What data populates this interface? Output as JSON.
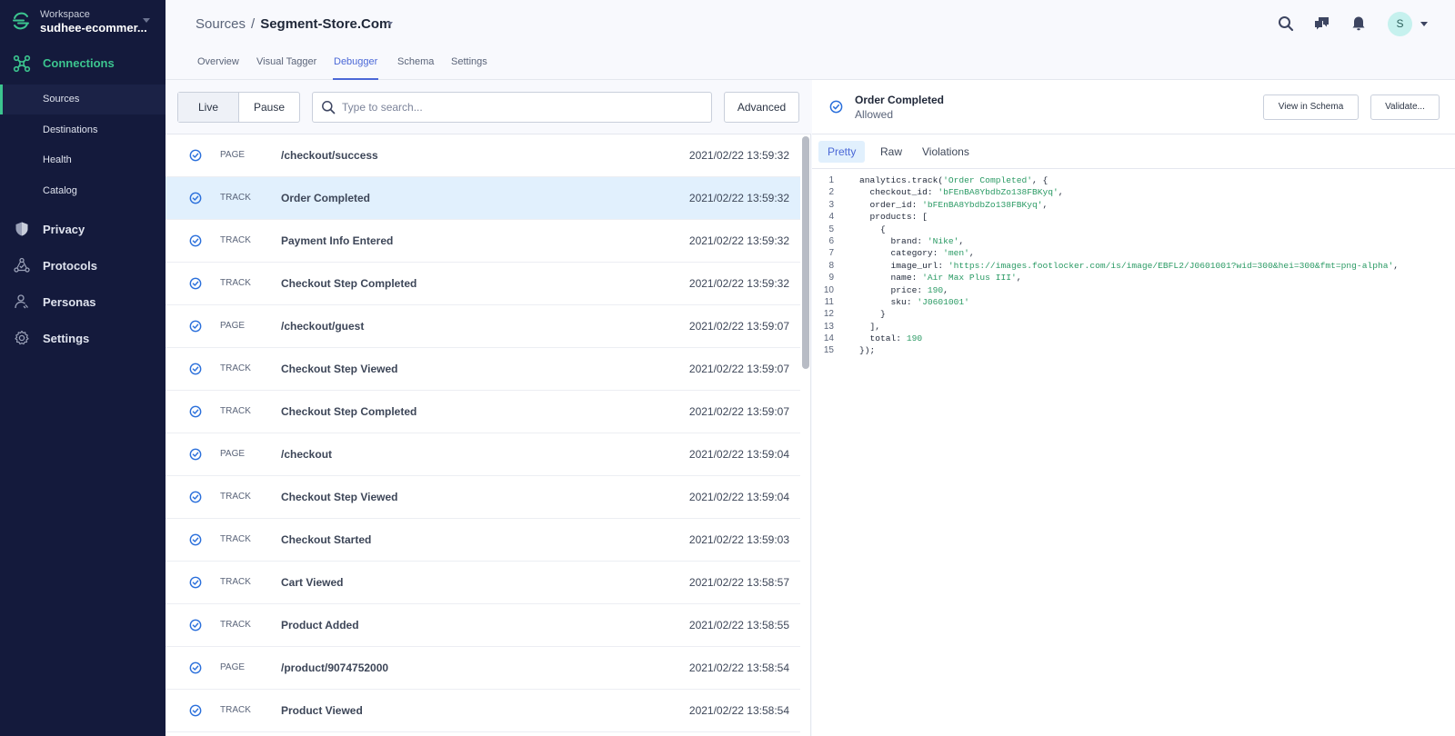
{
  "sidebar": {
    "workspace_label": "Workspace",
    "workspace_name": "sudhee-ecommer...",
    "connections_label": "Connections",
    "sub_items": [
      "Sources",
      "Destinations",
      "Health",
      "Catalog"
    ],
    "active_sub": "Sources",
    "items": [
      {
        "label": "Privacy",
        "icon": "shield-icon"
      },
      {
        "label": "Protocols",
        "icon": "protocols-icon"
      },
      {
        "label": "Personas",
        "icon": "persona-icon"
      },
      {
        "label": "Settings",
        "icon": "gear-icon"
      }
    ],
    "accent_color": "#3cc58f"
  },
  "header": {
    "breadcrumb_root": "Sources",
    "breadcrumb_sep": "/",
    "breadcrumb_current": "Segment-Store.Com",
    "tabs": [
      "Overview",
      "Visual Tagger",
      "Debugger",
      "Schema",
      "Settings"
    ],
    "active_tab": "Debugger",
    "avatar_initial": "S"
  },
  "toolbar": {
    "live_label": "Live",
    "pause_label": "Pause",
    "search_placeholder": "Type to search...",
    "search_value": "",
    "advanced_label": "Advanced"
  },
  "events": [
    {
      "type": "PAGE",
      "name": "/checkout/success",
      "timestamp": "2021/02/22 13:59:32",
      "selected": false
    },
    {
      "type": "TRACK",
      "name": "Order Completed",
      "timestamp": "2021/02/22 13:59:32",
      "selected": true
    },
    {
      "type": "TRACK",
      "name": "Payment Info Entered",
      "timestamp": "2021/02/22 13:59:32",
      "selected": false
    },
    {
      "type": "TRACK",
      "name": "Checkout Step Completed",
      "timestamp": "2021/02/22 13:59:32",
      "selected": false
    },
    {
      "type": "PAGE",
      "name": "/checkout/guest",
      "timestamp": "2021/02/22 13:59:07",
      "selected": false
    },
    {
      "type": "TRACK",
      "name": "Checkout Step Viewed",
      "timestamp": "2021/02/22 13:59:07",
      "selected": false
    },
    {
      "type": "TRACK",
      "name": "Checkout Step Completed",
      "timestamp": "2021/02/22 13:59:07",
      "selected": false
    },
    {
      "type": "PAGE",
      "name": "/checkout",
      "timestamp": "2021/02/22 13:59:04",
      "selected": false
    },
    {
      "type": "TRACK",
      "name": "Checkout Step Viewed",
      "timestamp": "2021/02/22 13:59:04",
      "selected": false
    },
    {
      "type": "TRACK",
      "name": "Checkout Started",
      "timestamp": "2021/02/22 13:59:03",
      "selected": false
    },
    {
      "type": "TRACK",
      "name": "Cart Viewed",
      "timestamp": "2021/02/22 13:58:57",
      "selected": false
    },
    {
      "type": "TRACK",
      "name": "Product Added",
      "timestamp": "2021/02/22 13:58:55",
      "selected": false
    },
    {
      "type": "PAGE",
      "name": "/product/9074752000",
      "timestamp": "2021/02/22 13:58:54",
      "selected": false
    },
    {
      "type": "TRACK",
      "name": "Product Viewed",
      "timestamp": "2021/02/22 13:58:54",
      "selected": false
    }
  ],
  "detail": {
    "title": "Order Completed",
    "status": "Allowed",
    "view_schema_label": "View in Schema",
    "validate_label": "Validate...",
    "tabs": [
      "Pretty",
      "Raw",
      "Violations"
    ],
    "active_tab": "Pretty",
    "code_lines": [
      [
        [
          "p",
          "analytics.track("
        ],
        [
          "s",
          "'Order Completed'"
        ],
        [
          "p",
          ", {"
        ]
      ],
      [
        [
          "p",
          "  checkout_id: "
        ],
        [
          "s",
          "'bFEnBA8YbdbZo138FBKyq'"
        ],
        [
          "p",
          ","
        ]
      ],
      [
        [
          "p",
          "  order_id: "
        ],
        [
          "s",
          "'bFEnBA8YbdbZo138FBKyq'"
        ],
        [
          "p",
          ","
        ]
      ],
      [
        [
          "p",
          "  products: ["
        ]
      ],
      [
        [
          "p",
          "    {"
        ]
      ],
      [
        [
          "p",
          "      brand: "
        ],
        [
          "s",
          "'Nike'"
        ],
        [
          "p",
          ","
        ]
      ],
      [
        [
          "p",
          "      category: "
        ],
        [
          "s",
          "'men'"
        ],
        [
          "p",
          ","
        ]
      ],
      [
        [
          "p",
          "      image_url: "
        ],
        [
          "s",
          "'https://images.footlocker.com/is/image/EBFL2/J0601001?wid=300&hei=300&fmt=png-alpha'"
        ],
        [
          "p",
          ","
        ]
      ],
      [
        [
          "p",
          "      name: "
        ],
        [
          "s",
          "'Air Max Plus III'"
        ],
        [
          "p",
          ","
        ]
      ],
      [
        [
          "p",
          "      price: "
        ],
        [
          "n",
          "190"
        ],
        [
          "p",
          ","
        ]
      ],
      [
        [
          "p",
          "      sku: "
        ],
        [
          "s",
          "'J0601001'"
        ]
      ],
      [
        [
          "p",
          "    }"
        ]
      ],
      [
        [
          "p",
          "  ],"
        ]
      ],
      [
        [
          "p",
          "  total: "
        ],
        [
          "n",
          "190"
        ]
      ],
      [
        [
          "p",
          "});"
        ]
      ]
    ]
  }
}
